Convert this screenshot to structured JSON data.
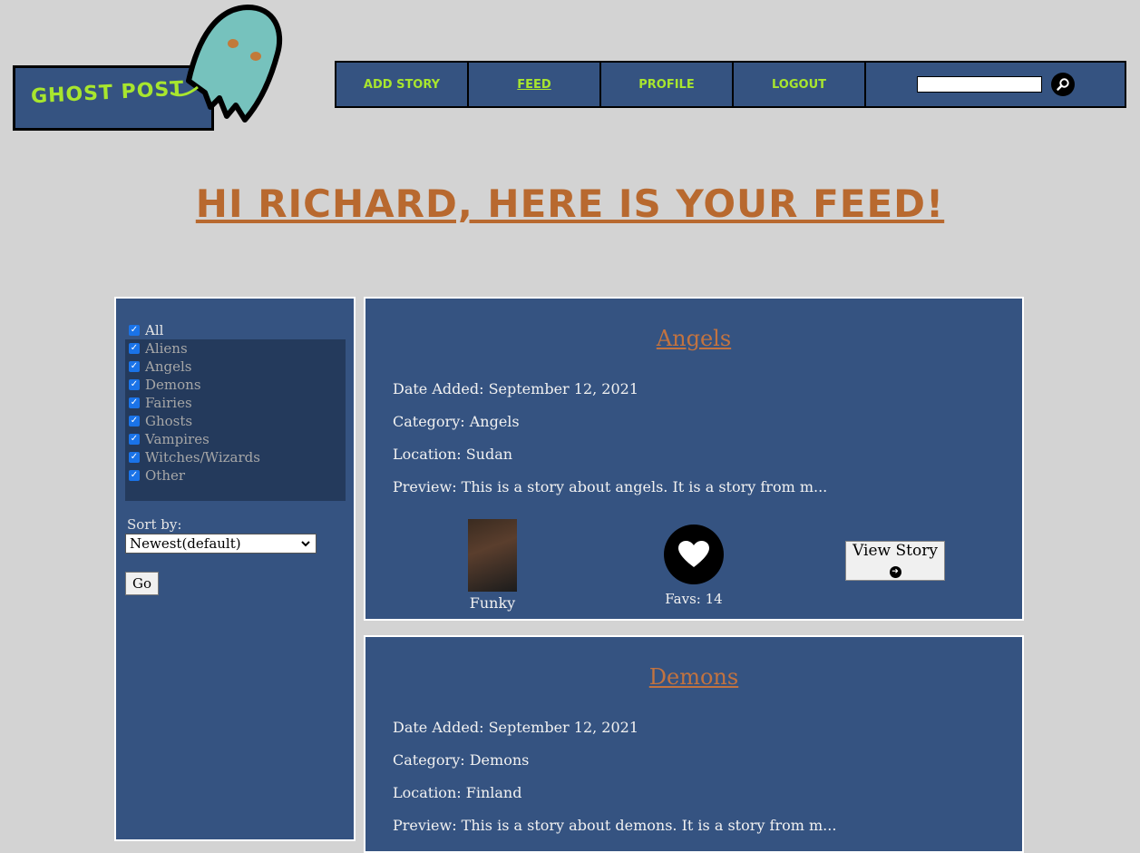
{
  "logo": {
    "text": "GHOST POST"
  },
  "nav": {
    "items": [
      {
        "label": "ADD STORY"
      },
      {
        "label": "FEED"
      },
      {
        "label": "PROFILE"
      },
      {
        "label": "LOGOUT"
      }
    ],
    "search_value": ""
  },
  "heading": "HI RICHARD, HERE IS YOUR FEED!",
  "filters": {
    "all_label": "All",
    "categories": [
      "Aliens",
      "Angels",
      "Demons",
      "Fairies",
      "Ghosts",
      "Vampires",
      "Witches/Wizards",
      "Other"
    ],
    "sort_label": "Sort by:",
    "sort_selected": "Newest(default)",
    "go_label": "Go"
  },
  "stories": [
    {
      "title": "Angels",
      "date": "Date Added: September 12, 2021",
      "category": "Category: Angels",
      "location": "Location: Sudan",
      "preview": "Preview: This is a story about angels. It is a story from m...",
      "author": "Funky",
      "favs": "Favs: 14",
      "view_label": "View Story"
    },
    {
      "title": "Demons",
      "date": "Date Added: September 12, 2021",
      "category": "Category: Demons",
      "location": "Location: Finland",
      "preview": "Preview: This is a story about demons. It is a story from m..."
    }
  ],
  "colors": {
    "background": "#d3d3d3",
    "panel": "#355381",
    "accent_green": "#a8e62e",
    "accent_orange": "#b8692f"
  }
}
